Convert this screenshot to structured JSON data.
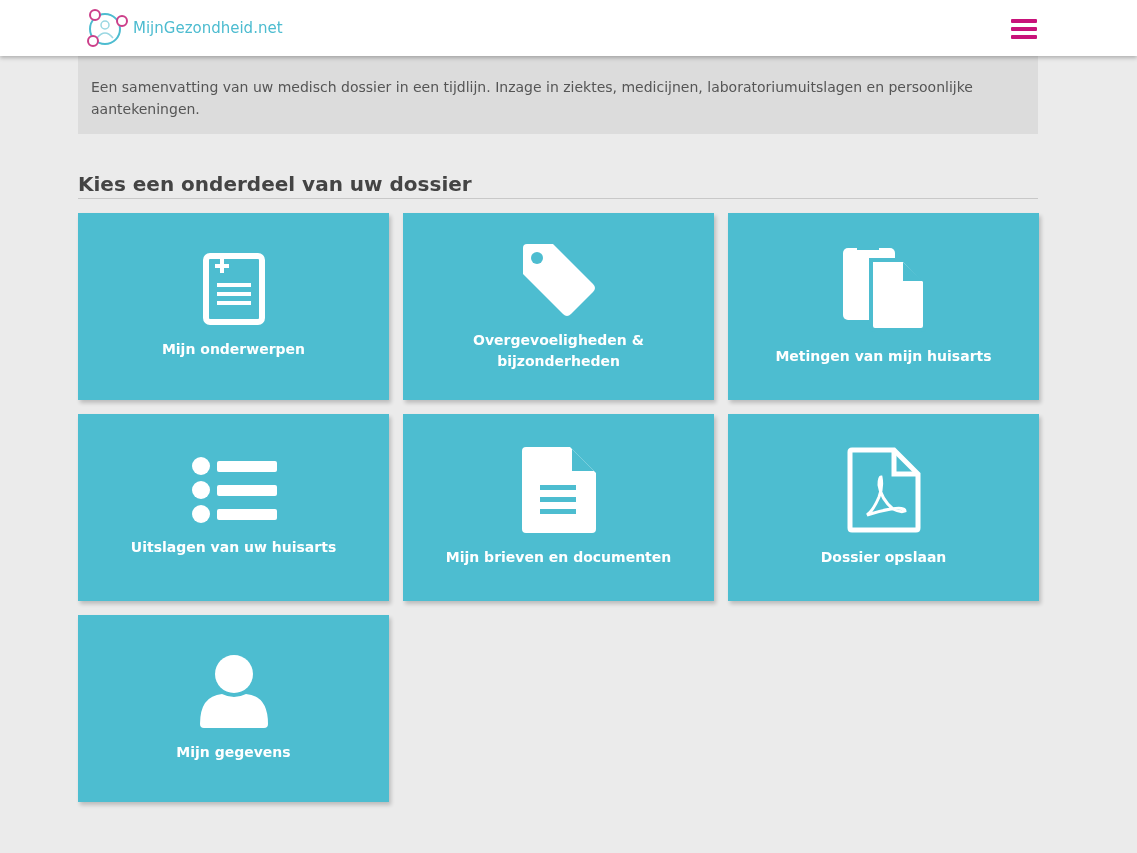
{
  "header": {
    "logo_text": "MijnGezondheid.net"
  },
  "intro": {
    "text": "Een samenvatting van uw medisch dossier in een tijdlijn. Inzage in ziektes, medicijnen, laboratoriumuitslagen en persoonlijke aantekeningen."
  },
  "section": {
    "title": "Kies een onderdeel van uw dossier"
  },
  "tiles": [
    {
      "kind": "record",
      "label": "Mijn onderwerpen"
    },
    {
      "kind": "tag",
      "label": "Overgevoeligheden & bijzonderheden"
    },
    {
      "kind": "copy",
      "label": "Metingen van mijn huisarts"
    },
    {
      "kind": "list",
      "label": "Uitslagen van uw huisarts"
    },
    {
      "kind": "document",
      "label": "Mijn brieven en documenten"
    },
    {
      "kind": "pdf",
      "label": "Dossier opslaan"
    },
    {
      "kind": "person",
      "label": "Mijn gegevens"
    }
  ]
}
